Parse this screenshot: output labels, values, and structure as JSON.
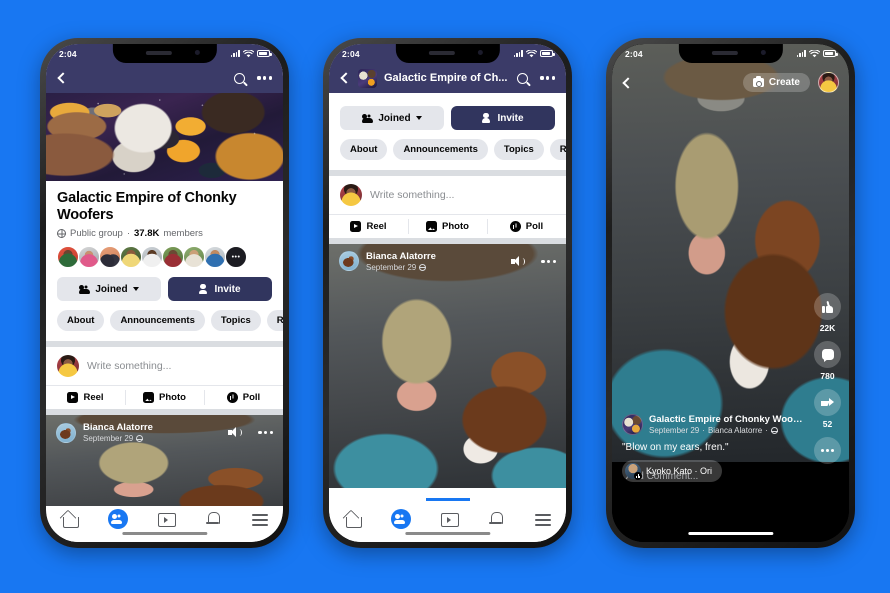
{
  "page": {
    "background_color": "#1877F2"
  },
  "common": {
    "status_time": "2:04",
    "icons": {
      "signal": "signal-bars-icon",
      "wifi": "wifi-icon",
      "battery": "battery-icon"
    }
  },
  "phone1": {
    "header": {
      "back_icon": "back-chevron-icon",
      "search_icon": "search-icon",
      "more_icon": "more-options-icon"
    },
    "cover_alt": "space-dogs-cover-photo",
    "group": {
      "name": "Galactic Empire of Chonky Woofers",
      "privacy": "Public group",
      "separator": "·",
      "member_count": "37.8K",
      "member_label": "members",
      "more_members": "•••"
    },
    "buttons": {
      "joined": "Joined",
      "invite": "Invite"
    },
    "tabs": [
      "About",
      "Announcements",
      "Topics",
      "Reels"
    ],
    "composer": {
      "placeholder": "Write something...",
      "options": [
        "Reel",
        "Photo",
        "Poll"
      ]
    },
    "post": {
      "author": "Bianca Alatorre",
      "date": "September 29",
      "sound_icon": "speaker-icon",
      "more_icon": "more-options-icon"
    },
    "bottomnav": [
      "home-icon",
      "groups-icon",
      "watch-icon",
      "notifications-icon",
      "menu-icon"
    ]
  },
  "phone2": {
    "header": {
      "back_icon": "back-chevron-icon",
      "title": "Galactic Empire of Ch...",
      "search_icon": "search-icon",
      "more_icon": "more-options-icon"
    },
    "buttons": {
      "joined": "Joined",
      "invite": "Invite"
    },
    "tabs": [
      "About",
      "Announcements",
      "Topics",
      "Reels"
    ],
    "composer": {
      "placeholder": "Write something...",
      "options": [
        "Reel",
        "Photo",
        "Poll"
      ]
    },
    "post": {
      "author": "Bianca Alatorre",
      "date": "September 29",
      "sound_icon": "speaker-icon",
      "more_icon": "more-options-icon"
    },
    "bottomnav": [
      "home-icon",
      "groups-icon",
      "watch-icon",
      "notifications-icon",
      "menu-icon"
    ]
  },
  "phone3": {
    "header": {
      "back_icon": "back-chevron-icon",
      "create_label": "Create",
      "camera_icon": "camera-icon",
      "profile_avatar": "user-avatar"
    },
    "rail": [
      {
        "icon": "like-thumb-icon",
        "count": "22K"
      },
      {
        "icon": "comment-bubble-icon",
        "count": "780"
      },
      {
        "icon": "share-arrow-icon",
        "count": "52"
      },
      {
        "icon": "more-options-icon",
        "count": ""
      }
    ],
    "info": {
      "group_name": "Galactic Empire of Chonky Woof...",
      "date": "September 29",
      "separator": "·",
      "author": "Bianca Alatorre",
      "audience_icon": "public-globe-icon",
      "caption": "\"Blow on my ears, fren.\"",
      "music": "Kyoko Kato · Ori"
    },
    "add_comment_placeholder": "Add Comment..."
  }
}
